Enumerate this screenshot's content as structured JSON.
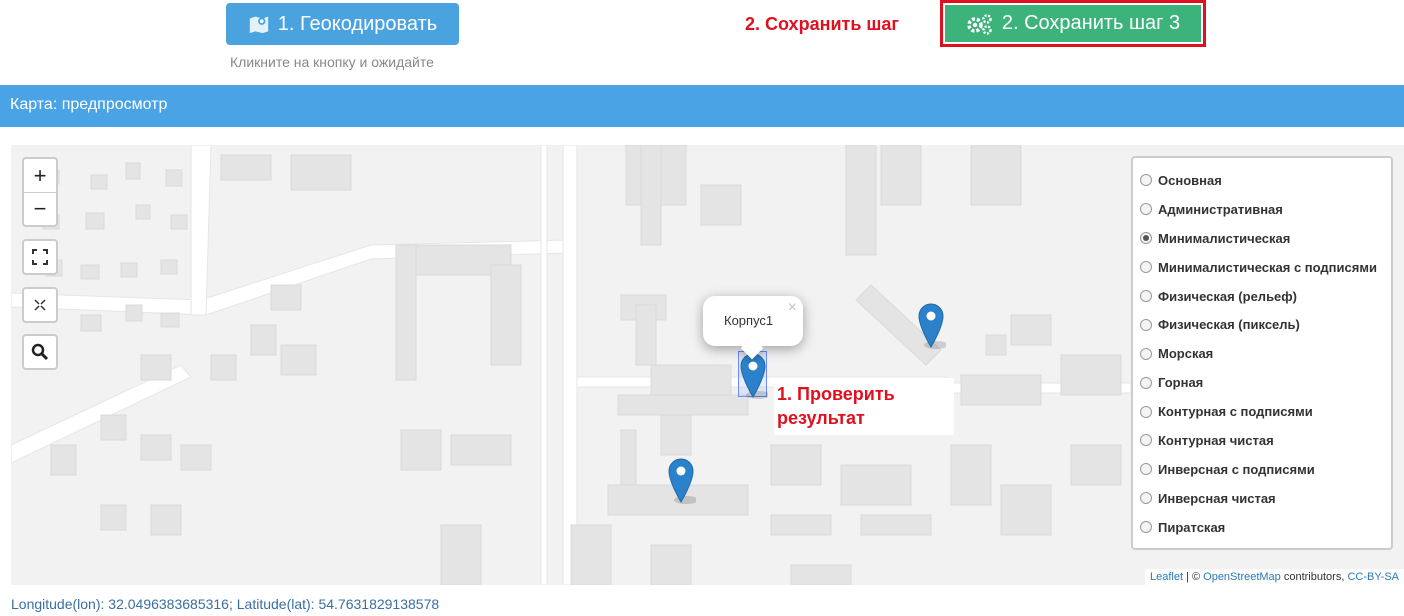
{
  "toolbar": {
    "geocode_label": "1. Геокодировать",
    "geocode_hint": "Кликните на кнопку и ожидайте",
    "step2_annotation": "2. Сохранить шаг",
    "save_label": "2. Сохранить шаг 3"
  },
  "panel": {
    "title": "Карта: предпросмотр"
  },
  "map": {
    "zoom_in": "+",
    "zoom_out": "−",
    "popup_text": "Корпус1",
    "popup_close": "×",
    "annotation_line1": "1. Проверить",
    "annotation_line2": "результат",
    "layers": [
      {
        "label": "Основная",
        "selected": false
      },
      {
        "label": "Административная",
        "selected": false
      },
      {
        "label": "Минималистическая",
        "selected": true
      },
      {
        "label": "Минималистическая с подписями",
        "selected": false
      },
      {
        "label": "Физическая (рельеф)",
        "selected": false
      },
      {
        "label": "Физическая (пиксель)",
        "selected": false
      },
      {
        "label": "Морская",
        "selected": false
      },
      {
        "label": "Горная",
        "selected": false
      },
      {
        "label": "Контурная с подписями",
        "selected": false
      },
      {
        "label": "Контурная чистая",
        "selected": false
      },
      {
        "label": "Инверсная с подписями",
        "selected": false
      },
      {
        "label": "Инверсная чистая",
        "selected": false
      },
      {
        "label": "Пиратская",
        "selected": false
      }
    ],
    "attribution": {
      "leaflet": "Leaflet",
      "sep": " | © ",
      "osm": "OpenStreetMap",
      "contributors": " contributors, ",
      "license": "CC-BY-SA"
    },
    "marker_color": "#2b82cb"
  },
  "coords": "Longitude(lon): 32.0496383685316; Latitude(lat): 54.7631829138578",
  "colors": {
    "primary": "#4aa3df",
    "success": "#3db37c",
    "annotation": "#e0101f"
  }
}
